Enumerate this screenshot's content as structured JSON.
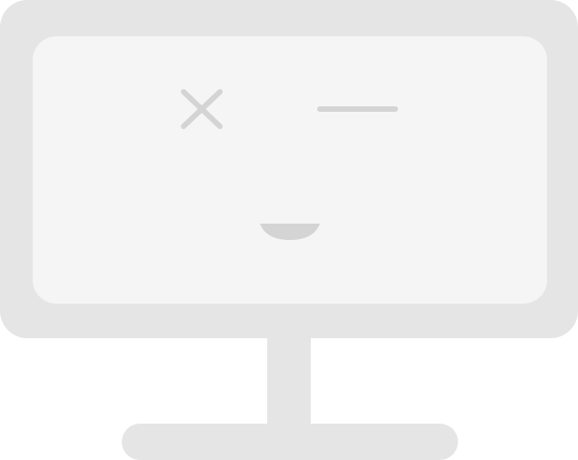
{
  "illustration": {
    "subject": "monitor-with-face-icon",
    "expression": "error-wink-smile",
    "colors": {
      "frame": "#e5e5e5",
      "screen": "#f5f5f5",
      "face": "#d4d4d4",
      "background": "#ffffff"
    }
  }
}
